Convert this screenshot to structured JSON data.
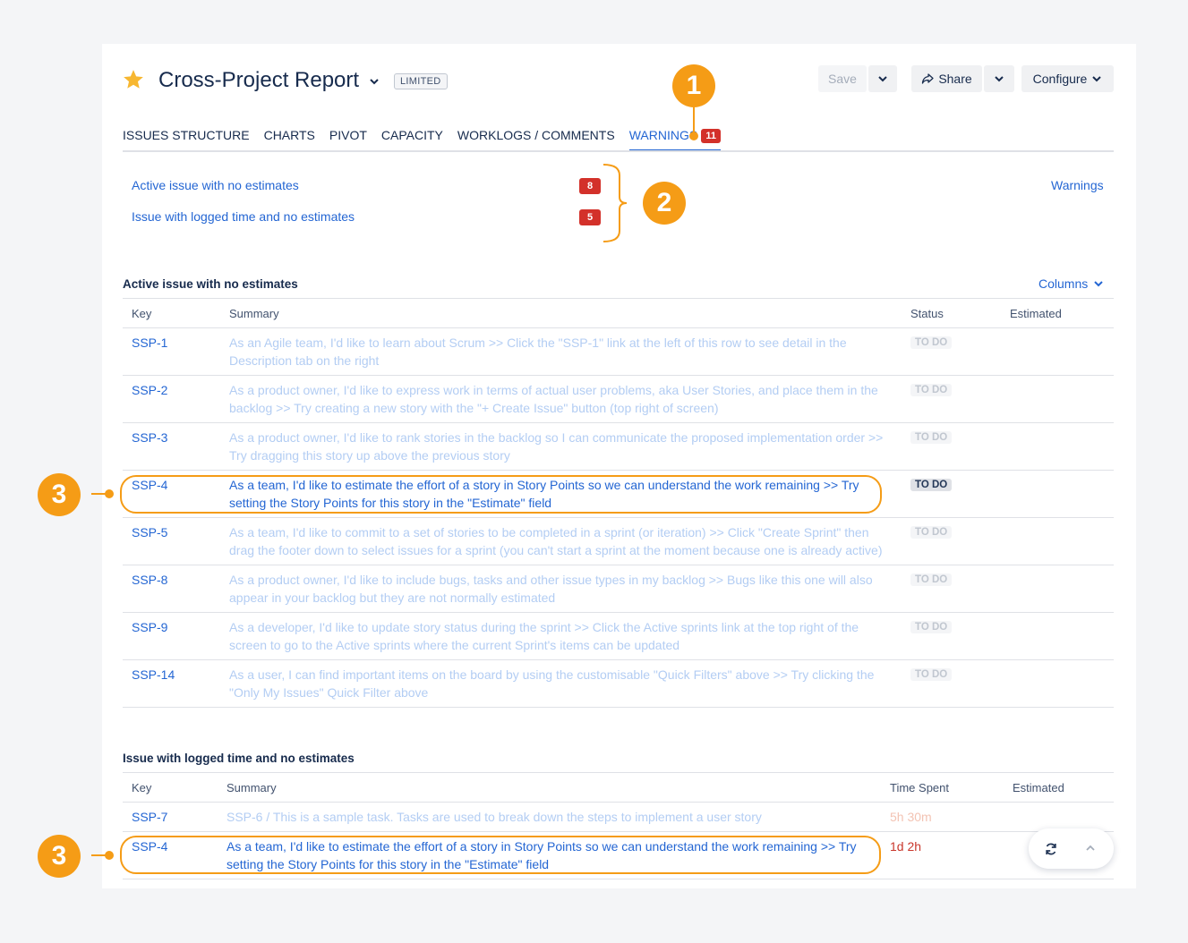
{
  "header": {
    "title": "Cross-Project Report",
    "badge": "LIMITED",
    "buttons": {
      "save": "Save",
      "share": "Share",
      "configure": "Configure"
    }
  },
  "tabs": [
    {
      "label": "ISSUES STRUCTURE"
    },
    {
      "label": "CHARTS"
    },
    {
      "label": "PIVOT"
    },
    {
      "label": "CAPACITY"
    },
    {
      "label": "WORKLOGS / COMMENTS"
    },
    {
      "label": "WARNINGS",
      "count": "11",
      "active": true
    }
  ],
  "warnings_summary": [
    {
      "label": "Active issue with no estimates",
      "count": "8"
    },
    {
      "label": "Issue with logged time and no estimates",
      "count": "5"
    }
  ],
  "warnings_link": "Warnings",
  "callouts": [
    "1",
    "2",
    "3",
    "3"
  ],
  "section1": {
    "title": "Active issue with no estimates",
    "columns_link": "Columns",
    "headers": {
      "key": "Key",
      "summary": "Summary",
      "status": "Status",
      "estimated": "Estimated"
    },
    "rows": [
      {
        "key": "SSP-1",
        "summary_1": "As an Agile team, I'd like to learn about Scrum >> Click the \"SSP-1\" link at the left of this row to see detail in the",
        "summary_2": "Description tab on the right",
        "status": "TO DO"
      },
      {
        "key": "SSP-2",
        "summary_1": "As a product owner, I'd like to express work in terms of actual user problems, aka User Stories, and place them in the",
        "summary_2": "backlog >> Try creating a new story with the \"+ Create Issue\" button (top right of screen)",
        "status": "TO DO"
      },
      {
        "key": "SSP-3",
        "summary_1": "As a product owner, I'd like to rank stories in the backlog so I can communicate the proposed implementation order >>",
        "summary_2": "Try dragging this story up above the previous story",
        "status": "TO DO"
      },
      {
        "key": "SSP-4",
        "summary_1": "As a team, I'd like to estimate the effort of a story in Story Points so we can understand the work remaining >> Try",
        "summary_2": "setting the Story Points for this story in the \"Estimate\" field",
        "status": "TO DO",
        "highlight": true
      },
      {
        "key": "SSP-5",
        "summary_1": "As a team, I'd like to commit to a set of stories to be completed in a sprint (or iteration) >> Click \"Create Sprint\" then",
        "summary_2": "drag the footer down to select issues for a sprint (you can't start a sprint at the moment because one is already active)",
        "status": "TO DO"
      },
      {
        "key": "SSP-8",
        "summary_1": "As a product owner, I'd like to include bugs, tasks and other issue types in my backlog >> Bugs like this one will also",
        "summary_2": "appear in your backlog but they are not normally estimated",
        "status": "TO DO"
      },
      {
        "key": "SSP-9",
        "summary_1": "As a developer, I'd like to update story status during the sprint >> Click the Active sprints link at the top right of the",
        "summary_2": "screen to go to the Active sprints where the current Sprint's items can be updated",
        "status": "TO DO"
      },
      {
        "key": "SSP-14",
        "summary_1": "As a user, I can find important items on the board by using the customisable \"Quick Filters\" above >> Try clicking the",
        "summary_2": "\"Only My Issues\" Quick Filter above",
        "status": "TO DO"
      }
    ]
  },
  "section2": {
    "title": "Issue with logged time and no estimates",
    "headers": {
      "key": "Key",
      "summary": "Summary",
      "time_spent": "Time Spent",
      "estimated": "Estimated"
    },
    "rows": [
      {
        "key": "SSP-7",
        "summary_1": "SSP-6 /  This is a sample task. Tasks are used to break down the steps to implement a user story",
        "summary_2": "",
        "time_spent": "5h 30m"
      },
      {
        "key": "SSP-4",
        "summary_1": "As a team, I'd like to estimate the effort of a story in Story Points so we can understand the work remaining >> Try",
        "summary_2": "setting the Story Points for this story in the \"Estimate\" field",
        "time_spent": "1d 2h",
        "highlight": true
      }
    ]
  },
  "colors": {
    "accent": "#2466d3",
    "callout": "#f59c16",
    "badge": "#d3312a"
  }
}
